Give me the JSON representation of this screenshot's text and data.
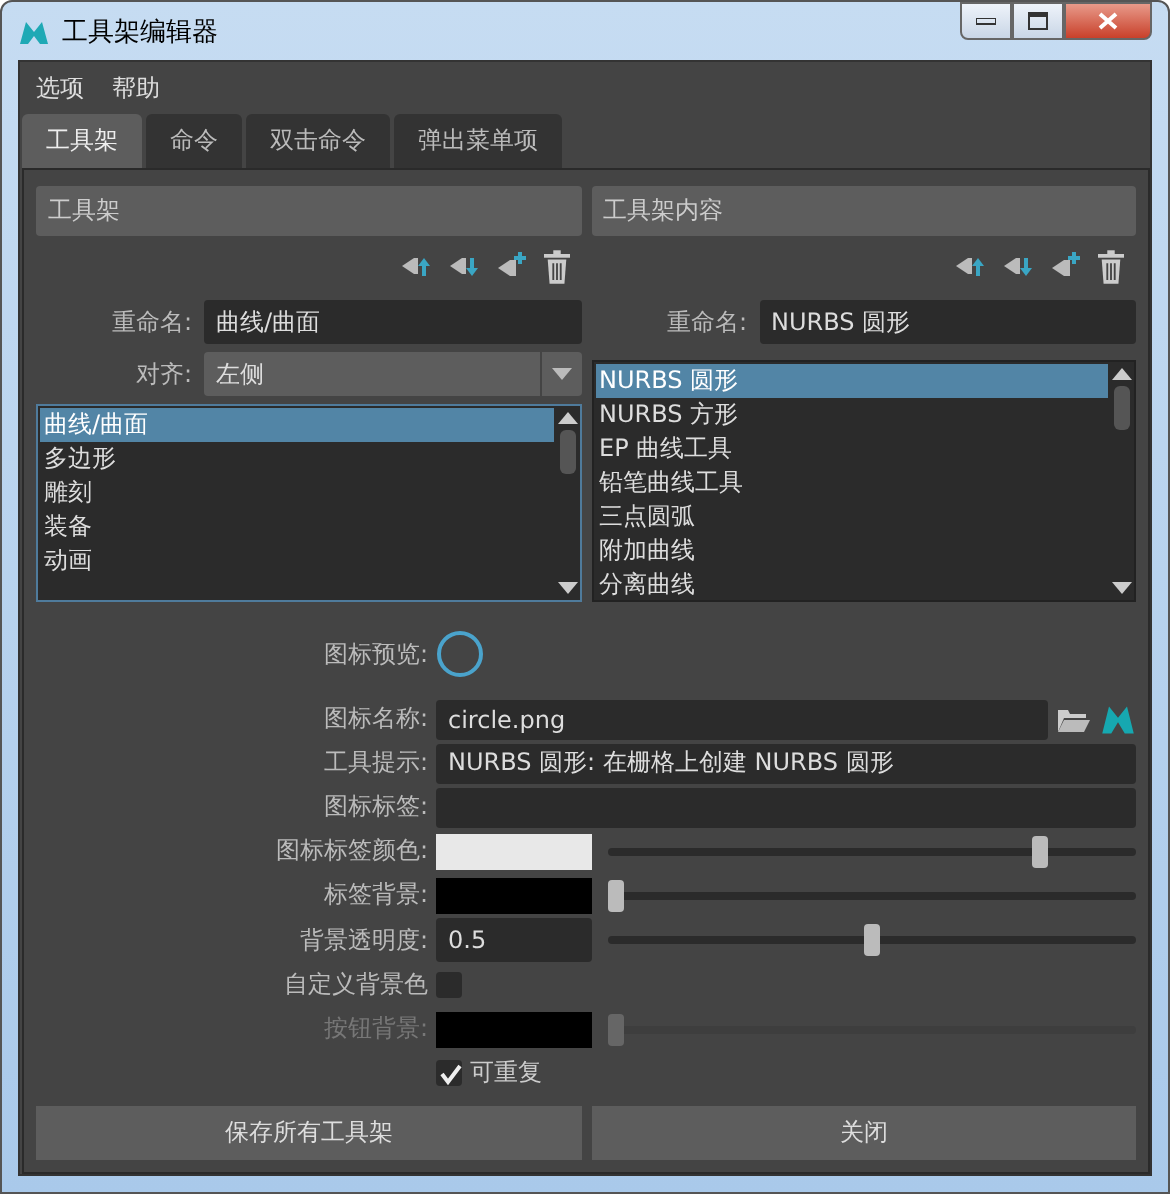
{
  "window": {
    "title": "工具架编辑器"
  },
  "menu": [
    "选项",
    "帮助"
  ],
  "tabs": [
    {
      "label": "工具架",
      "selected": true
    },
    {
      "label": "命令",
      "selected": false
    },
    {
      "label": "双击命令",
      "selected": false
    },
    {
      "label": "弹出菜单项",
      "selected": false
    }
  ],
  "shelves": {
    "header": "工具架",
    "rename_label": "重命名:",
    "rename_value": "曲线/曲面",
    "align_label": "对齐:",
    "align_value": "左侧",
    "items": [
      {
        "label": "曲线/曲面",
        "selected": true
      },
      {
        "label": "多边形",
        "selected": false
      },
      {
        "label": "雕刻",
        "selected": false
      },
      {
        "label": "装备",
        "selected": false
      },
      {
        "label": "动画",
        "selected": false
      }
    ]
  },
  "contents": {
    "header": "工具架内容",
    "rename_label": "重命名:",
    "rename_value": "NURBS 圆形",
    "items": [
      {
        "label": "NURBS 圆形",
        "selected": true
      },
      {
        "label": "NURBS 方形",
        "selected": false
      },
      {
        "label": "EP 曲线工具",
        "selected": false
      },
      {
        "label": "铅笔曲线工具",
        "selected": false
      },
      {
        "label": "三点圆弧",
        "selected": false
      },
      {
        "label": "附加曲线",
        "selected": false
      },
      {
        "label": "分离曲线",
        "selected": false
      }
    ]
  },
  "form": {
    "preview_label": "图标预览:",
    "fields": [
      {
        "label": "图标名称:",
        "value": "circle.png",
        "kind": "file"
      },
      {
        "label": "工具提示:",
        "value": "NURBS 圆形: 在栅格上创建 NURBS 圆形",
        "kind": "text"
      },
      {
        "label": "图标标签:",
        "kind": "text"
      }
    ],
    "sliders": [
      {
        "label": "图标标签颜色:",
        "kind": "color",
        "color": "#e8e8e8",
        "level": 0.83,
        "disabled": false
      },
      {
        "label": "标签背景:",
        "kind": "color",
        "color": "#000000",
        "level": 0.0,
        "disabled": false
      },
      {
        "label": "背景透明度:",
        "kind": "number",
        "value": "0.5",
        "level": 0.5,
        "disabled": false
      }
    ],
    "custom_bg": {
      "label": "自定义背景色",
      "checked": false
    },
    "button_bg": {
      "label": "按钮背景:",
      "kind": "color",
      "color": "#000000",
      "level": 0.0,
      "disabled": true
    },
    "repeatable": {
      "label": "可重复",
      "checked": true
    }
  },
  "buttons": [
    "保存所有工具架",
    "关闭"
  ]
}
